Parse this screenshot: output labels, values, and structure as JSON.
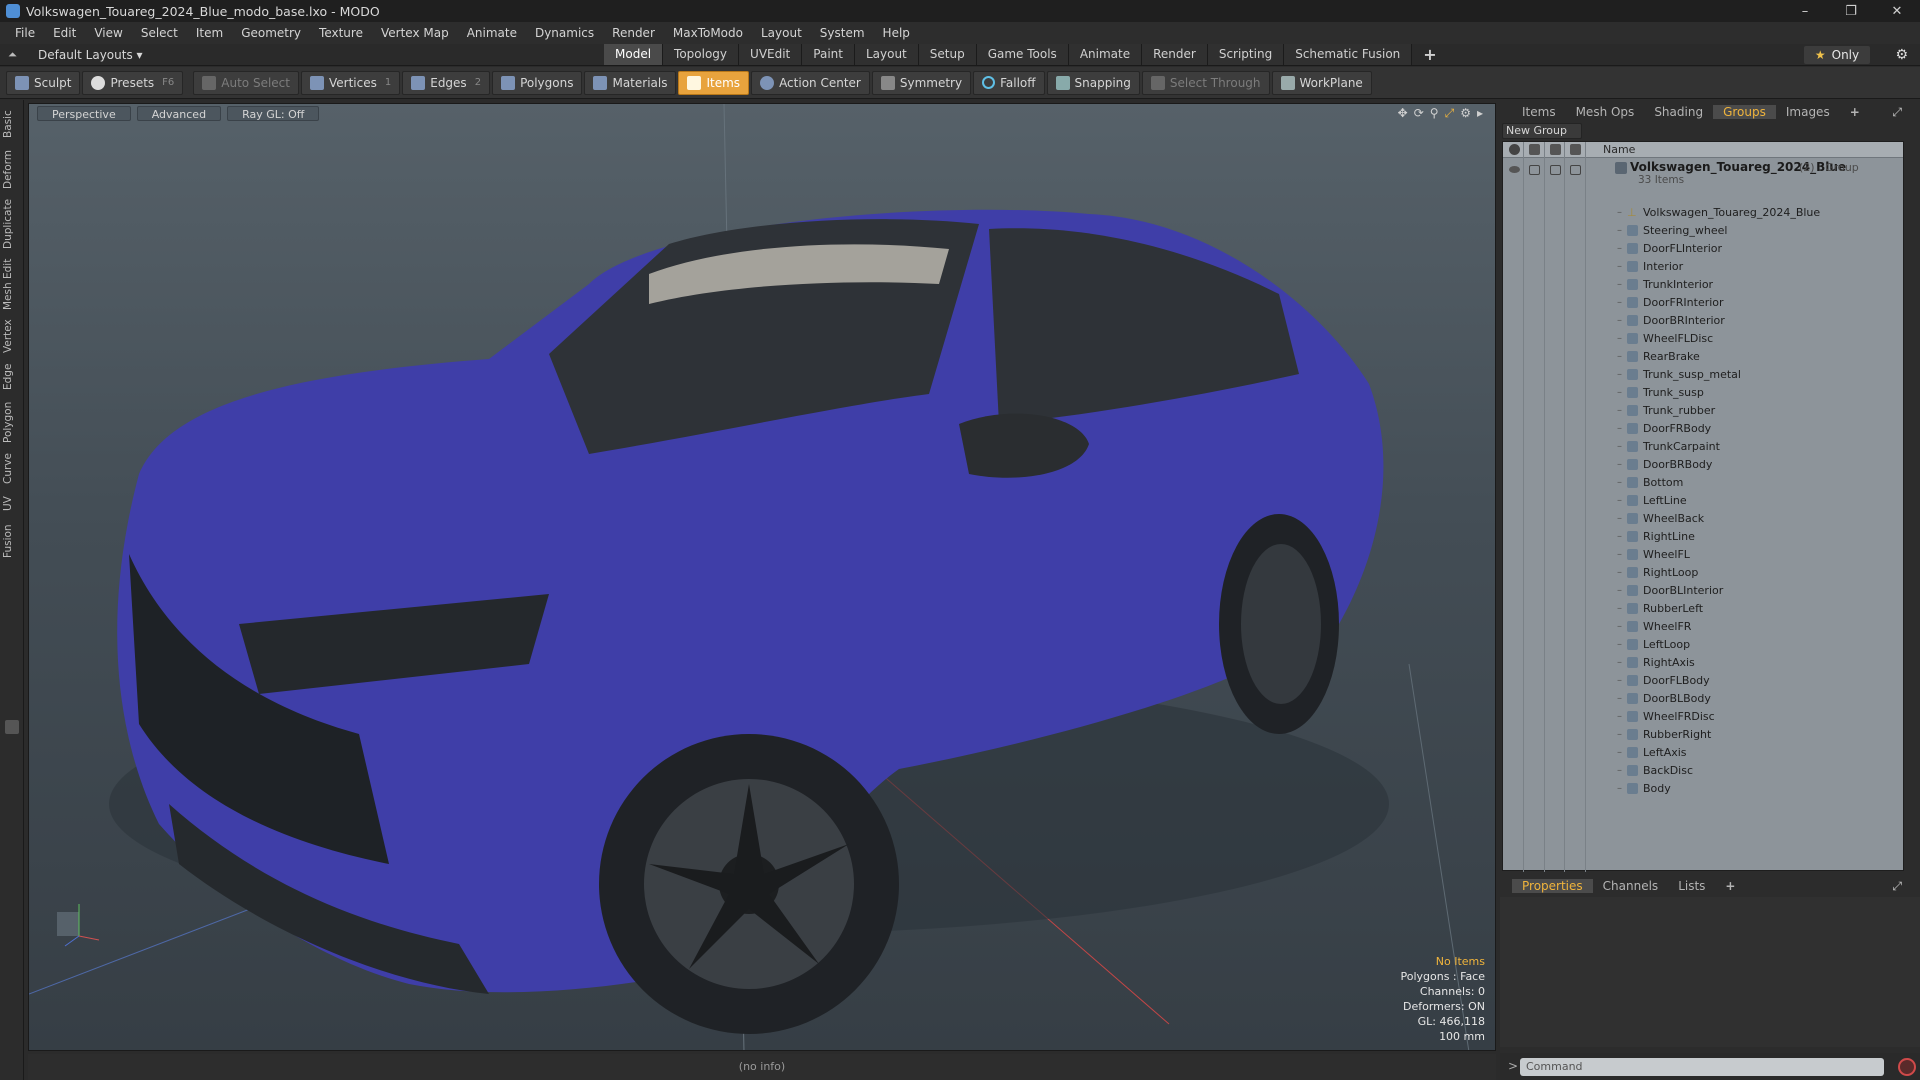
{
  "window": {
    "title": "Volkswagen_Touareg_2024_Blue_modo_base.lxo - MODO",
    "min": "–",
    "max": "❐",
    "close": "✕"
  },
  "menu": [
    "File",
    "Edit",
    "View",
    "Select",
    "Item",
    "Geometry",
    "Texture",
    "Vertex Map",
    "Animate",
    "Dynamics",
    "Render",
    "MaxToModo",
    "Layout",
    "System",
    "Help"
  ],
  "layoutbar": {
    "layout_name": "Default Layouts ▾",
    "tabs": [
      "Model",
      "Topology",
      "UVEdit",
      "Paint",
      "Layout",
      "Setup",
      "Game Tools",
      "Animate",
      "Render",
      "Scripting",
      "Schematic Fusion"
    ],
    "active_tab": "Model",
    "only_star": "★",
    "only_label": "Only"
  },
  "toolbar": {
    "sculpt": "Sculpt",
    "presets": "Presets",
    "presets_key": "F6",
    "auto_select": "Auto Select",
    "vertices": "Vertices",
    "vertices_key": "1",
    "edges": "Edges",
    "edges_key": "2",
    "polygons": "Polygons",
    "materials": "Materials",
    "items": "Items",
    "action_center": "Action Center",
    "symmetry": "Symmetry",
    "falloff": "Falloff",
    "snapping": "Snapping",
    "select_through": "Select Through",
    "workplane": "WorkPlane"
  },
  "left_tabs": [
    "Basic",
    "Deform",
    "Duplicate",
    "Mesh Edit",
    "Vertex",
    "Edge",
    "Polygon",
    "Curve",
    "UV",
    "Fusion"
  ],
  "viewport": {
    "view": "Perspective",
    "shading": "Advanced",
    "raygl": "Ray GL: Off",
    "info": {
      "selection": "No Items",
      "polygons": "Polygons : Face",
      "channels": "Channels: 0",
      "deformers": "Deformers: ON",
      "gl": "GL: 466,118",
      "scale": "100 mm"
    },
    "status": "(no info)",
    "car_color": "#3f3ea8"
  },
  "right_panel": {
    "tabs": [
      "Items",
      "Mesh Ops",
      "Shading",
      "Groups",
      "Images"
    ],
    "active_tab": "Groups",
    "new_group": "New Group",
    "column_name": "Name",
    "group": {
      "name": "Volkswagen_Touareg_2024_Blue",
      "meta": "(2) : Group",
      "count": "33 Items"
    },
    "items": [
      "Volkswagen_Touareg_2024_Blue",
      "Steering_wheel",
      "DoorFLInterior",
      "Interior",
      "TrunkInterior",
      "DoorFRInterior",
      "DoorBRInterior",
      "WheelFLDisc",
      "RearBrake",
      "Trunk_susp_metal",
      "Trunk_susp",
      "Trunk_rubber",
      "DoorFRBody",
      "TrunkCarpaint",
      "DoorBRBody",
      "Bottom",
      "LeftLine",
      "WheelBack",
      "RightLine",
      "WheelFL",
      "RightLoop",
      "DoorBLInterior",
      "RubberLeft",
      "WheelFR",
      "LeftLoop",
      "RightAxis",
      "DoorFLBody",
      "DoorBLBody",
      "WheelFRDisc",
      "RubberRight",
      "LeftAxis",
      "BackDisc",
      "Body"
    ],
    "bottom_tabs": [
      "Properties",
      "Channels",
      "Lists"
    ],
    "bottom_active": "Properties",
    "command_placeholder": "Command"
  }
}
